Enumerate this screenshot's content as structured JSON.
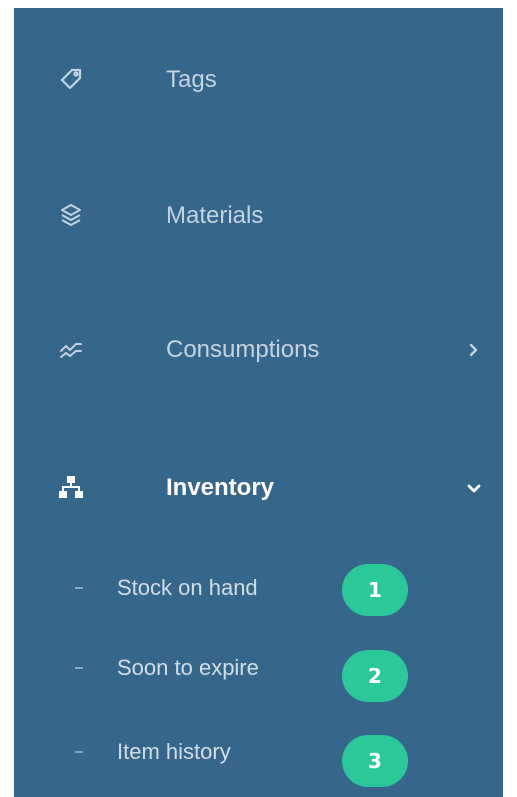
{
  "menu": {
    "items": [
      {
        "label": "Tags",
        "icon": "tag-icon",
        "chevron": null
      },
      {
        "label": "Materials",
        "icon": "materials-icon",
        "chevron": null
      },
      {
        "label": "Consumptions",
        "icon": "consumptions-icon",
        "chevron": "chevron-right-icon"
      },
      {
        "label": "Inventory",
        "icon": "inventory-icon",
        "chevron": "chevron-down-icon",
        "active": true
      }
    ]
  },
  "inventory_submenu": [
    {
      "label": "Stock on hand",
      "step": "1"
    },
    {
      "label": "Soon to expire",
      "step": "2"
    },
    {
      "label": "Item history",
      "step": "3"
    }
  ],
  "colors": {
    "sidebar_bg": "#36668a",
    "text_inactive": "#c4d3df",
    "text_active": "#ffffff",
    "badge_bg": "#2bc99a"
  }
}
